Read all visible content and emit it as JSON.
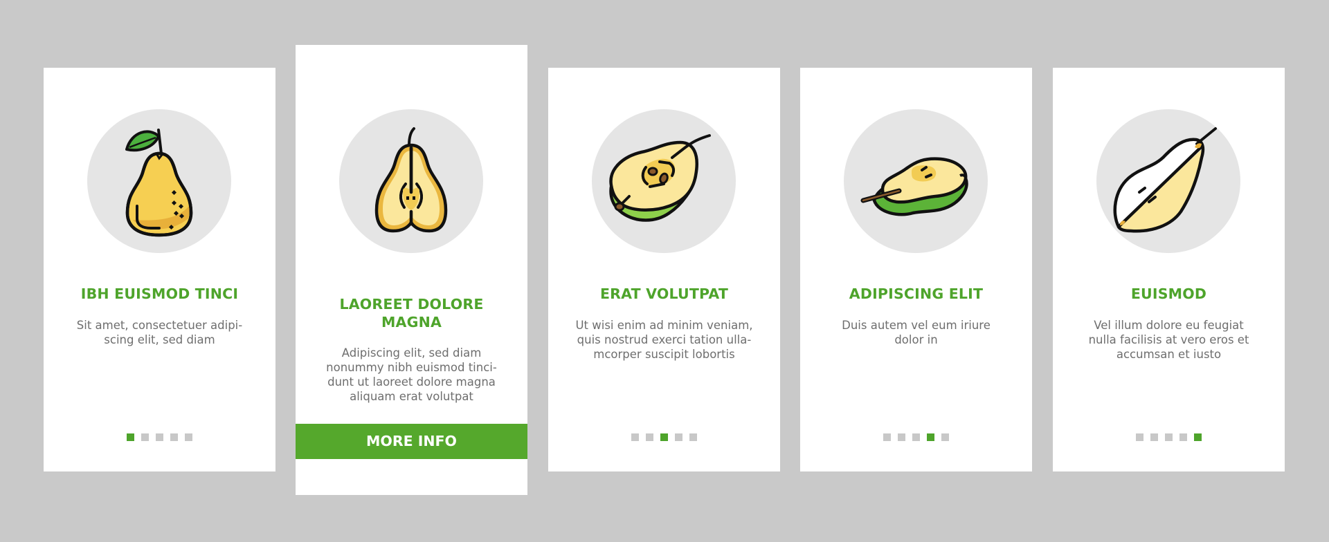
{
  "theme": {
    "accent": "#4ea42b",
    "button_bg": "#55a82c",
    "background": "#c9c9c9",
    "card_bg": "#ffffff",
    "icon_circle": "#e5e5e5",
    "dot_inactive": "#c8c8c8",
    "text_gray": "#6e6e6e"
  },
  "cards": [
    {
      "icon": "whole-pear-with-leaf-icon",
      "title": "IBH EUISMOD TINCI",
      "description": "Sit amet, consectetuer adipi-\nscing elit, sed diam",
      "active_page": 1,
      "total_pages": 5
    },
    {
      "icon": "pear-cross-section-icon",
      "title": "LAOREET DOLORE\nMAGNA",
      "description": "Adipiscing elit, sed diam\nnonummy nibh euismod tinci-\ndunt ut laoreet dolore magna\naliquam erat volutpat",
      "button_label": "MORE INFO"
    },
    {
      "icon": "pear-half-seeds-icon",
      "title": "ERAT VOLUTPAT",
      "description": "Ut wisi enim ad minim veniam,\nquis nostrud exerci tation ulla-\nmcorper suscipit lobortis",
      "active_page": 3,
      "total_pages": 5
    },
    {
      "icon": "green-pear-half-icon",
      "title": "ADIPISCING ELIT",
      "description": "Duis autem vel eum iriure\ndolor in",
      "active_page": 4,
      "total_pages": 5
    },
    {
      "icon": "pear-slice-icon",
      "title": "EUISMOD",
      "description": "Vel illum dolore eu feugiat\nnulla facilisis at vero eros et\naccumsan et iusto",
      "active_page": 5,
      "total_pages": 5
    }
  ]
}
